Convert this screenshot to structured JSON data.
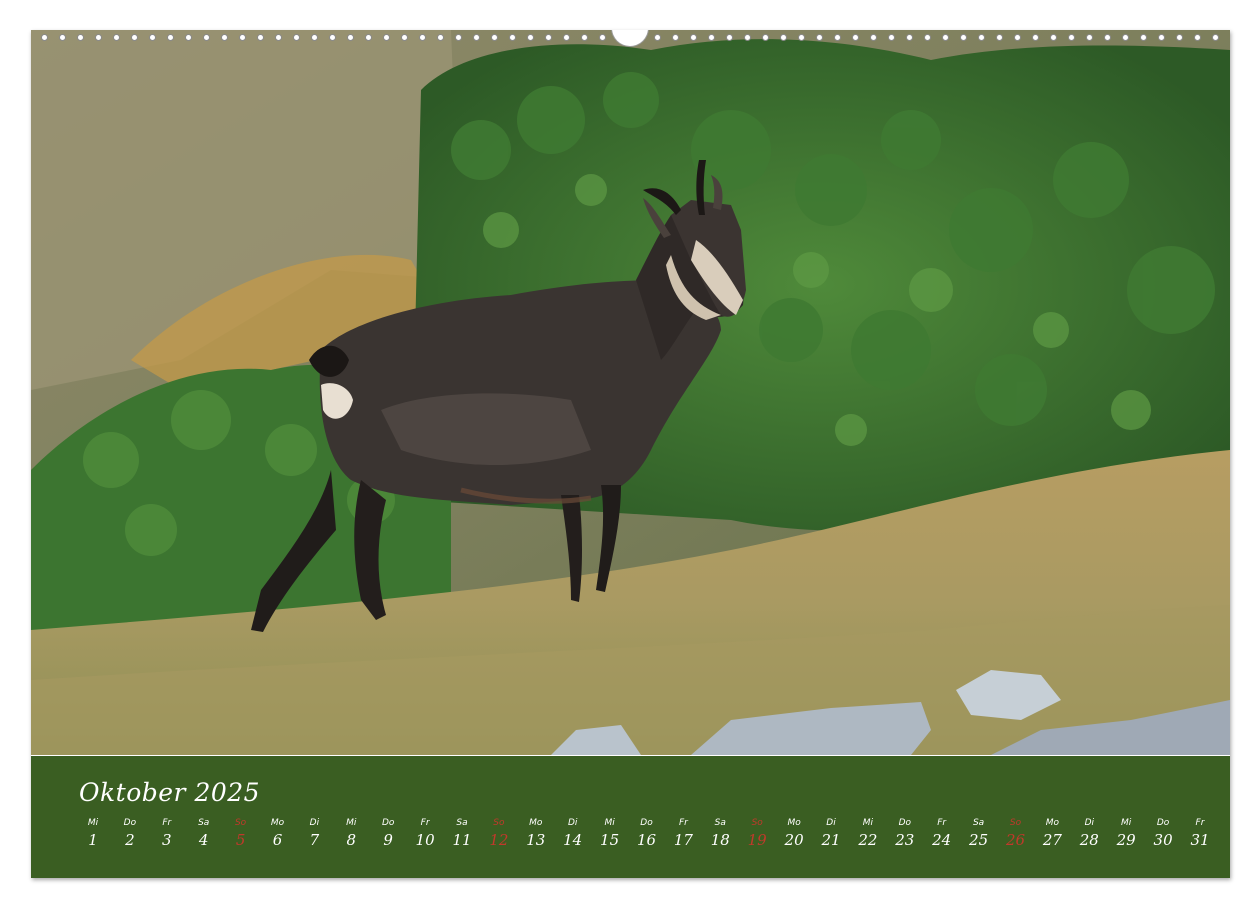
{
  "calendar": {
    "month_title": "Oktober 2025",
    "days": [
      {
        "wd": "Mi",
        "d": "1"
      },
      {
        "wd": "Do",
        "d": "2"
      },
      {
        "wd": "Fr",
        "d": "3"
      },
      {
        "wd": "Sa",
        "d": "4"
      },
      {
        "wd": "So",
        "d": "5",
        "sun": true
      },
      {
        "wd": "Mo",
        "d": "6"
      },
      {
        "wd": "Di",
        "d": "7"
      },
      {
        "wd": "Mi",
        "d": "8"
      },
      {
        "wd": "Do",
        "d": "9"
      },
      {
        "wd": "Fr",
        "d": "10"
      },
      {
        "wd": "Sa",
        "d": "11"
      },
      {
        "wd": "So",
        "d": "12",
        "sun": true
      },
      {
        "wd": "Mo",
        "d": "13"
      },
      {
        "wd": "Di",
        "d": "14"
      },
      {
        "wd": "Mi",
        "d": "15"
      },
      {
        "wd": "Do",
        "d": "16"
      },
      {
        "wd": "Fr",
        "d": "17"
      },
      {
        "wd": "Sa",
        "d": "18"
      },
      {
        "wd": "So",
        "d": "19",
        "sun": true
      },
      {
        "wd": "Mo",
        "d": "20"
      },
      {
        "wd": "Di",
        "d": "21"
      },
      {
        "wd": "Mi",
        "d": "22"
      },
      {
        "wd": "Do",
        "d": "23"
      },
      {
        "wd": "Fr",
        "d": "24"
      },
      {
        "wd": "Sa",
        "d": "25"
      },
      {
        "wd": "So",
        "d": "26",
        "sun": true
      },
      {
        "wd": "Mo",
        "d": "27"
      },
      {
        "wd": "Di",
        "d": "28"
      },
      {
        "wd": "Mi",
        "d": "29"
      },
      {
        "wd": "Do",
        "d": "30"
      },
      {
        "wd": "Fr",
        "d": "31"
      }
    ]
  },
  "colors": {
    "calendar_band": "#3a5e22",
    "sunday": "#c0392b",
    "text": "#ffffff"
  }
}
